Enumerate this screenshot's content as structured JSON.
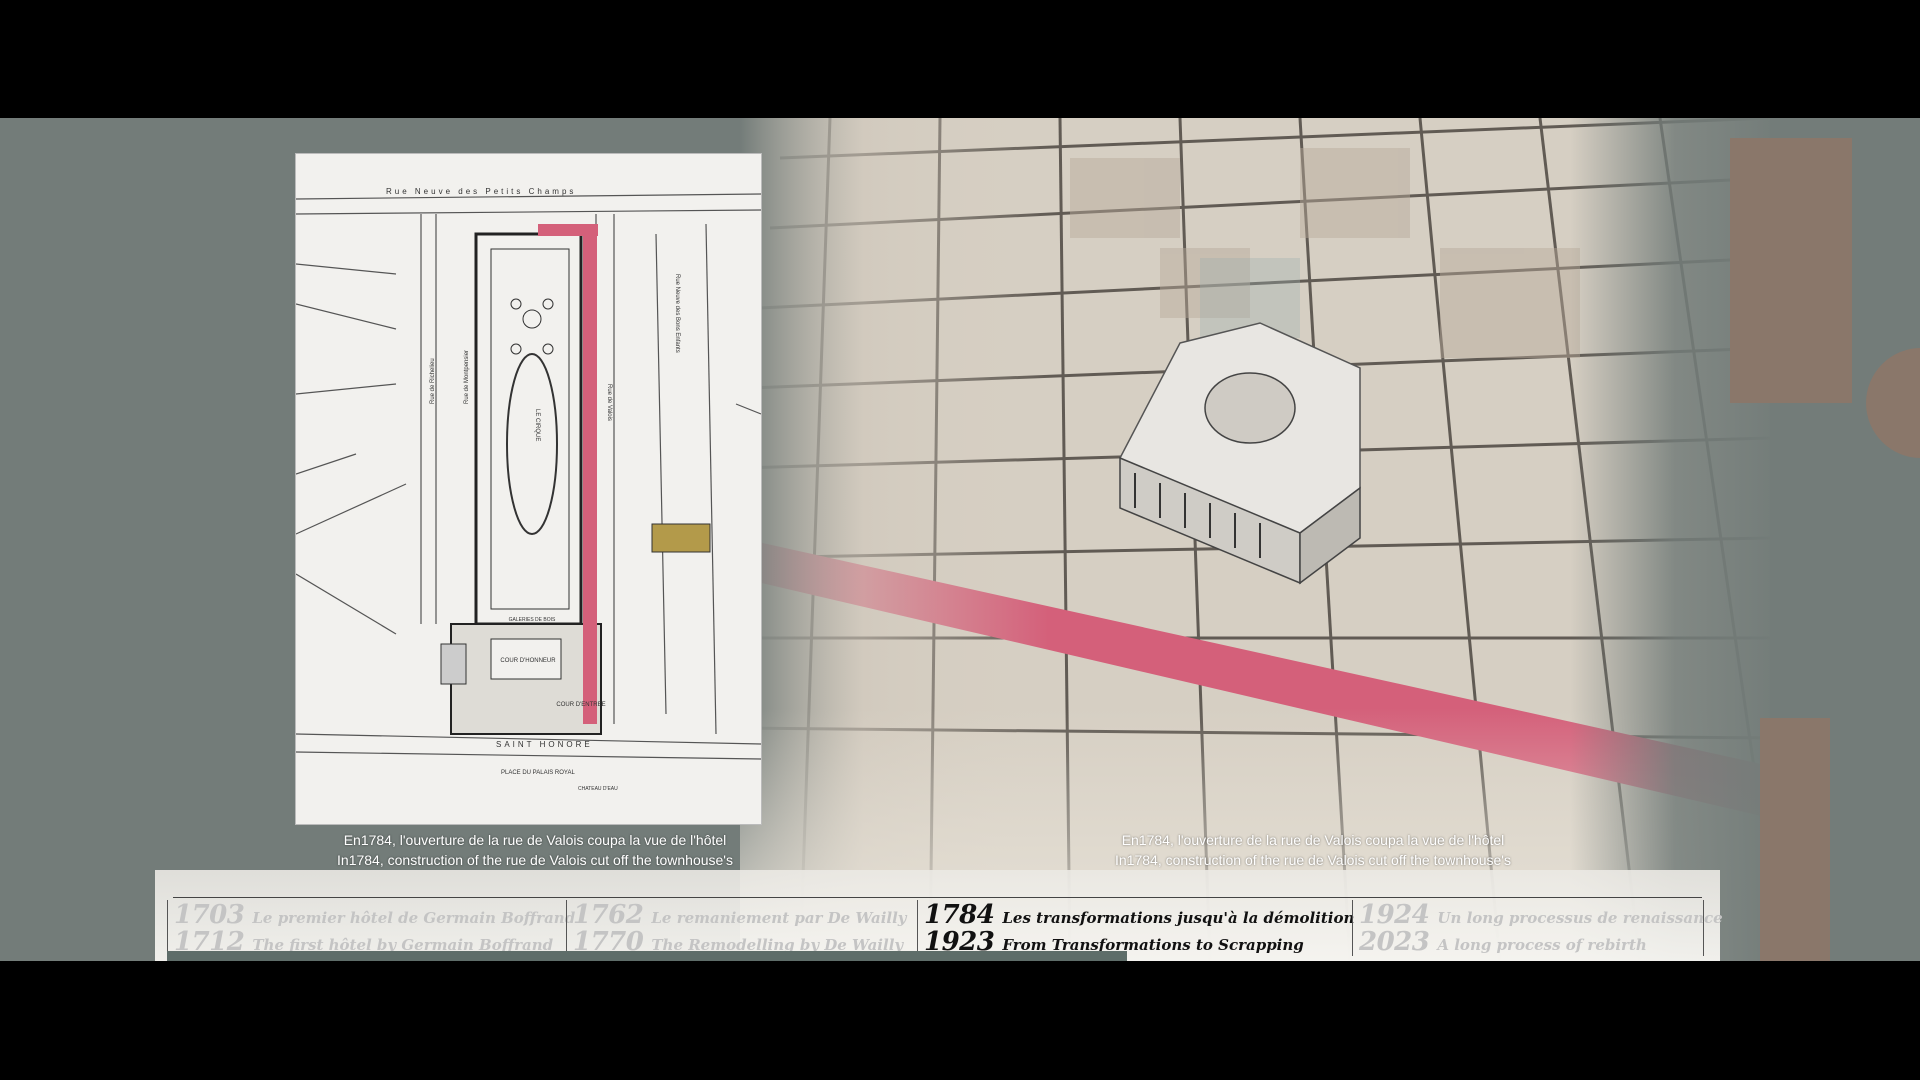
{
  "captions": {
    "left": {
      "line1": "En1784, l'ouverture de la rue de Valois coupa la vue de l'hôtel",
      "line2": "In1784, construction of the rue de Valois cut off the townhouse's"
    },
    "right": {
      "line1": "En1784, l'ouverture de la rue de Valois coupa la vue de l'hôtel",
      "line2": "In1784, construction of the rue de Valois cut off the townhouse's"
    }
  },
  "plan_labels": {
    "top_street": "Rue Neuve des Petits Champs",
    "bottom_street": "SAINT HONORE",
    "place": "PLACE DU PALAIS ROYAL",
    "chateau": "CHATEAU D'EAU",
    "cirque": "LE CIRQUE",
    "cour_honneur": "COUR D'HONNEUR",
    "cour_entree": "COUR D'ENTREE",
    "galeries": "GALERIES DE BOIS",
    "rue_valois": "Rue de Valois",
    "rue_richelieu": "Rue de Richelieu",
    "rue_montpensier": "Rue de Montpensier",
    "rue_bons_enfants": "Rue Neuve des Bons Enfants"
  },
  "timeline": {
    "eras": [
      {
        "year_fr": "1703",
        "title_fr": "Le premier hôtel de Germain Boffrand",
        "year_en": "1712",
        "title_en": "The first hôtel by Germain Boffrand",
        "active": false
      },
      {
        "year_fr": "1762",
        "title_fr": "Le remaniement par De Wailly",
        "year_en": "1770",
        "title_en": "The Remodelling by De Wailly",
        "active": false
      },
      {
        "year_fr": "1784",
        "title_fr": "Les transformations jusqu'à la démolition",
        "year_en": "1923",
        "title_en": "From Transformations to Scrapping",
        "active": true
      },
      {
        "year_fr": "1924",
        "title_fr": "Un long processus de renaissance",
        "year_en": "2023",
        "title_en": "A long process of rebirth",
        "active": false
      }
    ],
    "progress": 0.62
  },
  "colors": {
    "street_highlight": "#d4607a",
    "building_highlight": "#b39a4a",
    "background": "#737c79"
  }
}
